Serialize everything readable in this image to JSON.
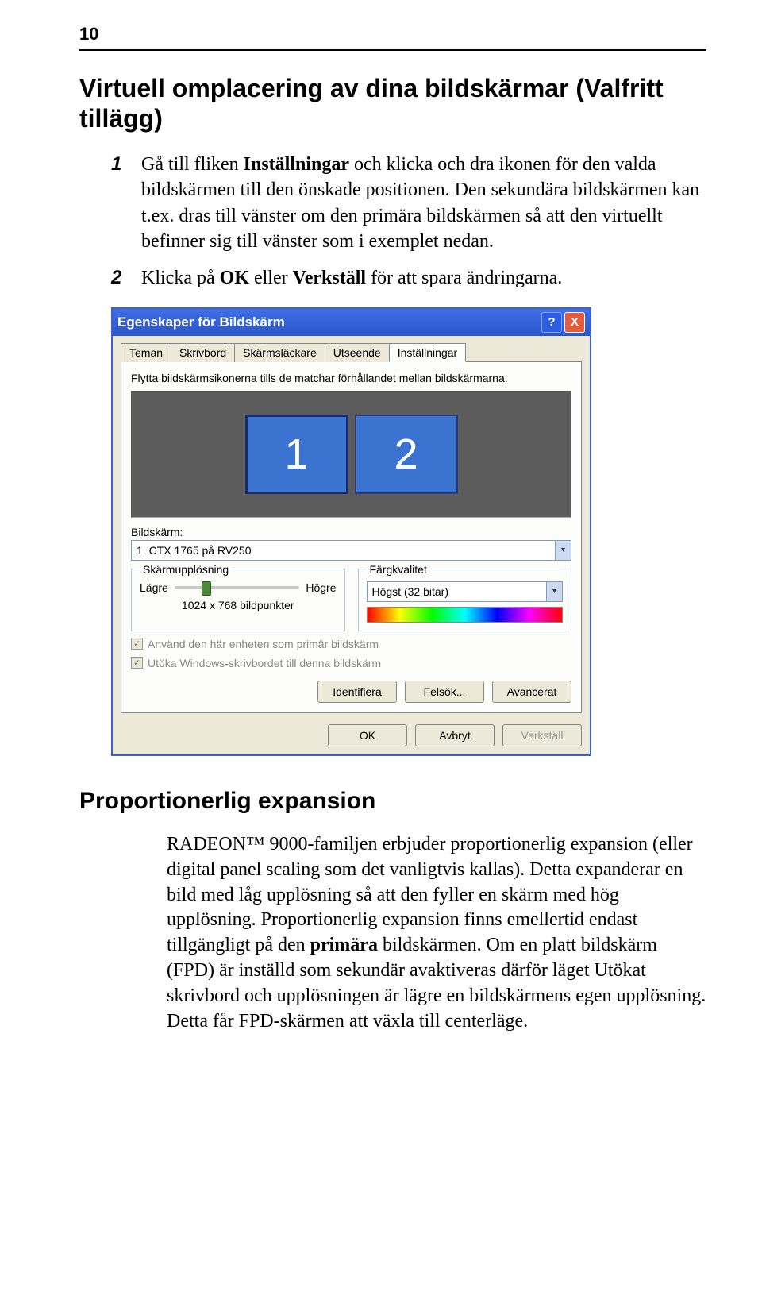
{
  "page_number": "10",
  "h1": "Virtuell omplacering av dina bildskärmar (Valfritt tillägg)",
  "steps": [
    {
      "num": "1",
      "html": "Gå till fliken <b>Inställningar</b> och klicka och dra ikonen för den valda bildskärmen till den önskade positionen. Den sekundära bildskärmen kan t.ex. dras till vänster om den primära bildskärmen så att den virtuellt befinner sig till vänster som i exemplet nedan."
    },
    {
      "num": "2",
      "html": "Klicka på <b>OK</b> eller <b>Verkställ</b> för att spara ändringarna."
    }
  ],
  "dialog": {
    "title": "Egenskaper för Bildskärm",
    "help": "?",
    "close": "X",
    "tabs": [
      "Teman",
      "Skrivbord",
      "Skärmsläckare",
      "Utseende",
      "Inställningar"
    ],
    "active_tab": 4,
    "info": "Flytta bildskärmsikonerna tills de matchar förhållandet mellan bildskärmarna.",
    "monitors": [
      "1",
      "2"
    ],
    "bildskarm_label": "Bildskärm:",
    "bildskarm_value": "1. CTX 1765 på RV250",
    "res_group": "Skärmupplösning",
    "res_low": "Lägre",
    "res_high": "Högre",
    "res_value": "1024 x 768 bildpunkter",
    "color_group": "Färgkvalitet",
    "color_value": "Högst (32 bitar)",
    "chk1": "Använd den här enheten som primär bildskärm",
    "chk2": "Utöka Windows-skrivbordet till denna bildskärm",
    "btn_identify": "Identifiera",
    "btn_troubleshoot": "Felsök...",
    "btn_advanced": "Avancerat",
    "btn_ok": "OK",
    "btn_cancel": "Avbryt",
    "btn_apply": "Verkställ"
  },
  "h2": "Proportionerlig expansion",
  "para_html": "RADEON™ 9000-familjen erbjuder proportionerlig expansion (eller digital panel scaling som det vanligtvis kallas). Detta expanderar en bild med låg upplösning så att den fyller en skärm med hög upplösning. Proportionerlig expansion finns emellertid endast tillgängligt på den <b>primära</b> bildskärmen. Om en platt bildskärm (FPD) är inställd som sekundär avaktiveras därför läget Utökat skrivbord och upplösningen är lägre en bildskärmens egen upplösning. Detta får FPD-skärmen att växla till centerläge."
}
